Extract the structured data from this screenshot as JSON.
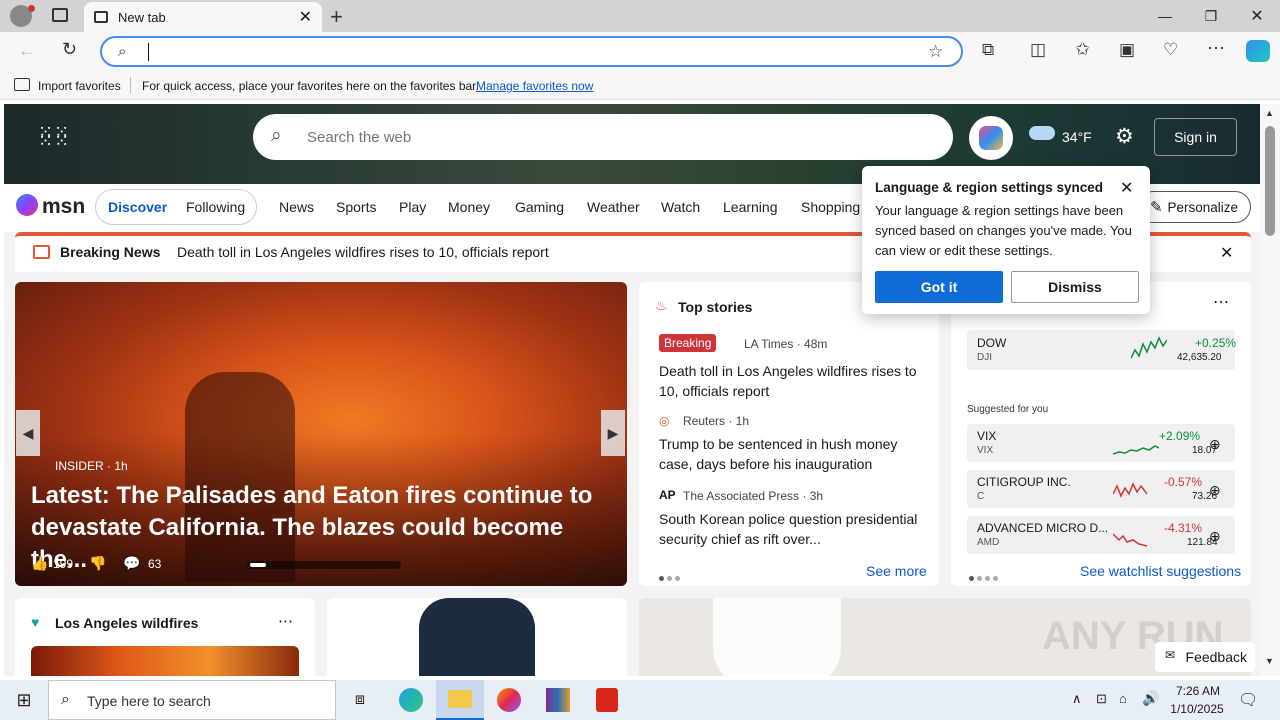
{
  "browser": {
    "tab_title": "New tab",
    "address_value": "",
    "favbar": {
      "import_label": "Import favorites",
      "hint": "For quick access, place your favorites here on the favorites bar.",
      "manage_link": "Manage favorites now"
    }
  },
  "msn": {
    "search_placeholder": "Search the web",
    "temperature": "34°F",
    "signin": "Sign in",
    "logo": "msn",
    "discover": "Discover",
    "following": "Following",
    "nav": [
      "News",
      "Sports",
      "Play",
      "Money",
      "Gaming",
      "Weather",
      "Watch",
      "Learning",
      "Shopping"
    ],
    "personalize": "Personalize",
    "breaking_label": "Breaking News",
    "breaking_text": "Death toll in Los Angeles wildfires rises to 10, officials report",
    "hero": {
      "source": "INSIDER · 1h",
      "headline": "Latest: The Palisades and Eaton fires continue to devastate California. The blazes could become the...",
      "likes": "199",
      "comments": "63"
    },
    "top_stories": {
      "title": "Top stories",
      "items": [
        {
          "badge": "Breaking",
          "source": "LA Times · 48m",
          "headline": "Death toll in Los Angeles wildfires rises to 10, officials report"
        },
        {
          "source": "Reuters · 1h",
          "headline": "Trump to be sentenced in hush money case, days before his inauguration"
        },
        {
          "source": "The Associated Press · 3h",
          "headline": "South Korean police question presidential security chief as rift over..."
        }
      ],
      "see_more": "See more"
    },
    "markets": {
      "dow": {
        "name": "DOW",
        "ticker": "DJI",
        "change": "+0.25%",
        "value": "42,635.20"
      },
      "suggested_label": "Suggested for you",
      "items": [
        {
          "name": "VIX",
          "ticker": "VIX",
          "change": "+2.09%",
          "value": "18.07",
          "color": "#0a8f3a"
        },
        {
          "name": "CITIGROUP INC.",
          "ticker": "C",
          "change": "-0.57%",
          "value": "73.26",
          "color": "#d13438"
        },
        {
          "name": "ADVANCED MICRO D...",
          "ticker": "AMD",
          "change": "-4.31%",
          "value": "121.84",
          "color": "#d13438"
        }
      ],
      "see_watchlist": "See watchlist suggestions"
    },
    "wildfires_title": "Los Angeles wildfires",
    "feedback": "Feedback"
  },
  "popup": {
    "title": "Language & region settings synced",
    "body": "Your language & region settings have been synced based on changes you've made. You can view or edit these settings.",
    "got_it": "Got it",
    "dismiss": "Dismiss"
  },
  "taskbar": {
    "search_placeholder": "Type here to search",
    "time": "7:26 AM",
    "date": "1/10/2025"
  },
  "watermark": "ANY RUN"
}
